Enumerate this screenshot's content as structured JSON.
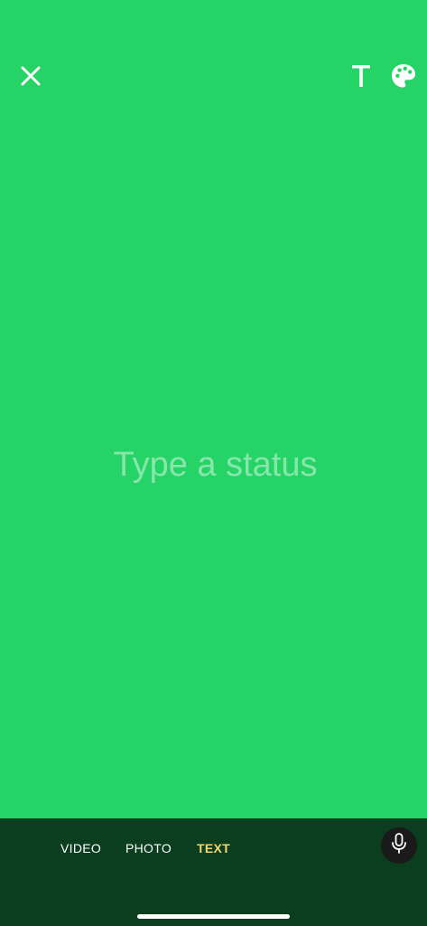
{
  "colors": {
    "background": "#25d366",
    "bottom_bar": "#0b3d1f",
    "active_tab": "#f5d76e",
    "mic_button": "#1a1a1a"
  },
  "header": {
    "close_icon": "close-icon",
    "text_style_icon": "text-style-icon",
    "text_style_glyph": "T",
    "palette_icon": "palette-icon"
  },
  "editor": {
    "placeholder": "Type a status",
    "value": ""
  },
  "modes": {
    "tabs": [
      {
        "label": "VIDEO",
        "active": false
      },
      {
        "label": "PHOTO",
        "active": false
      },
      {
        "label": "TEXT",
        "active": true
      }
    ]
  },
  "voice": {
    "icon": "microphone-icon"
  }
}
